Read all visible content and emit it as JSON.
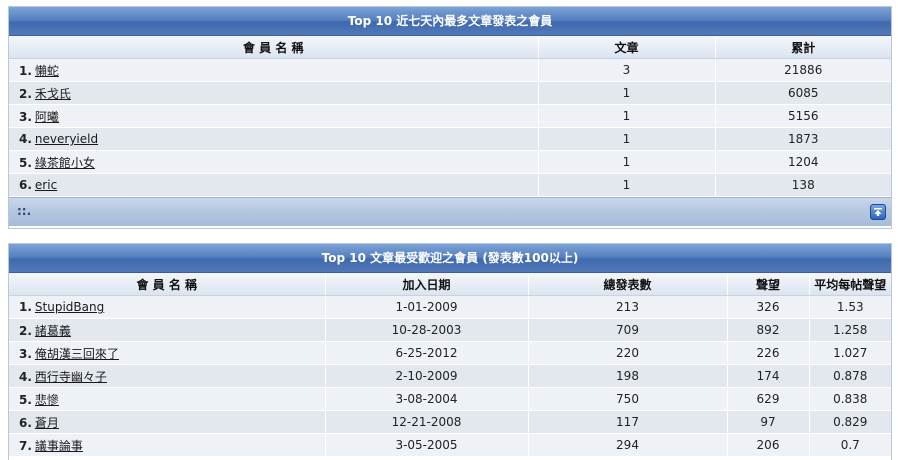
{
  "panel1": {
    "title": "Top 10 近七天內最多文章發表之會員",
    "headers": [
      "會 員 名 稱",
      "文章",
      "累計"
    ],
    "rows": [
      {
        "rank": "1.",
        "name": "懶蛇",
        "articles": "3",
        "total": "21886"
      },
      {
        "rank": "2.",
        "name": "禾戈氏",
        "articles": "1",
        "total": "6085"
      },
      {
        "rank": "3.",
        "name": "阿曦",
        "articles": "1",
        "total": "5156"
      },
      {
        "rank": "4.",
        "name": "neveryield",
        "articles": "1",
        "total": "1873"
      },
      {
        "rank": "5.",
        "name": "綠茶館小女",
        "articles": "1",
        "total": "1204"
      },
      {
        "rank": "6.",
        "name": "eric",
        "articles": "1",
        "total": "138"
      }
    ],
    "footer_text": "::.",
    "footer_icon": "back-to-top-icon"
  },
  "panel2": {
    "title": "Top 10 文章最受歡迎之會員 (發表數100以上)",
    "headers": [
      "會 員 名 稱",
      "加入日期",
      "總發表數",
      "聲望",
      "平均每帖聲望"
    ],
    "rows": [
      {
        "rank": "1.",
        "name": "StupidBang",
        "joined": "1-01-2009",
        "posts": "213",
        "rep": "326",
        "avg": "1.53"
      },
      {
        "rank": "2.",
        "name": "諸葛義",
        "joined": "10-28-2003",
        "posts": "709",
        "rep": "892",
        "avg": "1.258"
      },
      {
        "rank": "3.",
        "name": "俺胡漢三回來了",
        "joined": "6-25-2012",
        "posts": "220",
        "rep": "226",
        "avg": "1.027"
      },
      {
        "rank": "4.",
        "name": "西行寺幽々子",
        "joined": "2-10-2009",
        "posts": "198",
        "rep": "174",
        "avg": "0.878"
      },
      {
        "rank": "5.",
        "name": "悲慘",
        "joined": "3-08-2004",
        "posts": "750",
        "rep": "629",
        "avg": "0.838"
      },
      {
        "rank": "6.",
        "name": "蒼月",
        "joined": "12-21-2008",
        "posts": "117",
        "rep": "97",
        "avg": "0.829"
      },
      {
        "rank": "7.",
        "name": "議事論事",
        "joined": "3-05-2005",
        "posts": "294",
        "rep": "206",
        "avg": "0.7"
      }
    ]
  }
}
